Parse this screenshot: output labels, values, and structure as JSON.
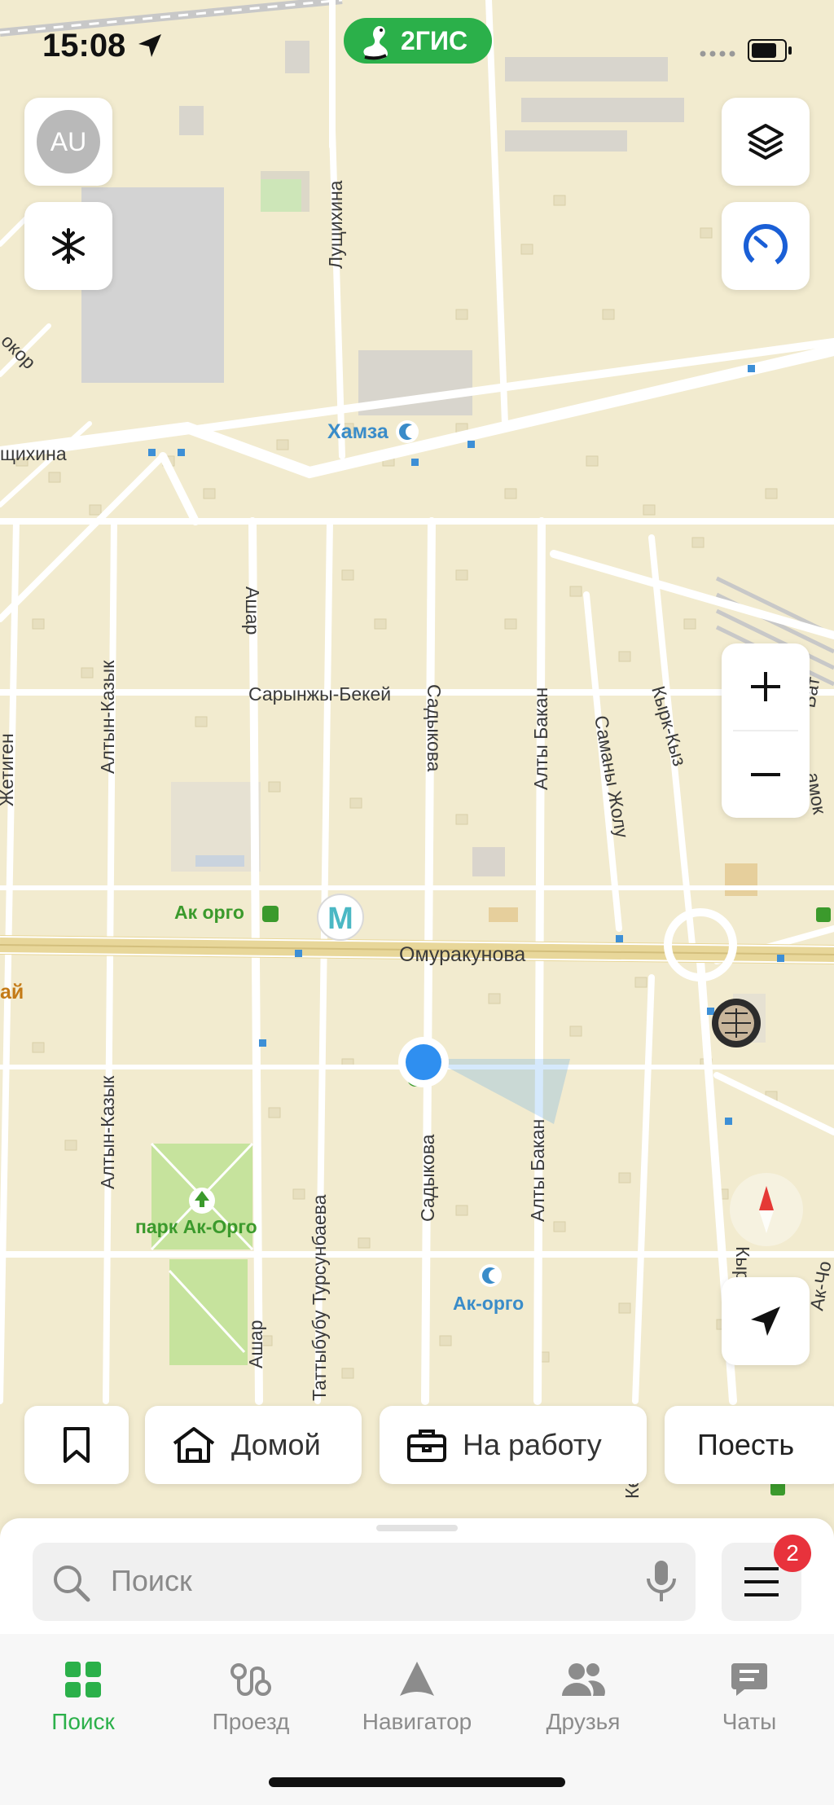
{
  "status": {
    "time": "15:08",
    "app_logo": "2ГИС"
  },
  "profile": {
    "initials": "AU"
  },
  "map": {
    "streets": [
      {
        "text": "Лущихина"
      },
      {
        "text": "щихина"
      },
      {
        "text": "окор"
      },
      {
        "text": "Ашар"
      },
      {
        "text": "Сарынжы-Бекей"
      },
      {
        "text": "Садыкова"
      },
      {
        "text": "Алты Бакан"
      },
      {
        "text": "Саманы Жолу"
      },
      {
        "text": "Кырк-Кыз"
      },
      {
        "text": "Алтын-Казык"
      },
      {
        "text": "Жетиген"
      },
      {
        "text": "Омуракунова"
      },
      {
        "text": "Алтын-Казык"
      },
      {
        "text": "Таттыбубу Турсунбаева"
      },
      {
        "text": "Садыкова"
      },
      {
        "text": "Алты Бакан"
      },
      {
        "text": "Ашар"
      },
      {
        "text": "Кыр"
      },
      {
        "text": "Ак-Чо"
      },
      {
        "text": "Бат"
      },
      {
        "text": "амок"
      },
      {
        "text": "Кер"
      }
    ],
    "pois": {
      "hamza": "Хамза",
      "ak_orgo_metro": "Ак орго",
      "metro_letter": "М",
      "park": "парк Ак-Орго",
      "mosque": "Ак-орго",
      "edge_label": "ай"
    }
  },
  "controls": {
    "zoom_in": "+",
    "zoom_out": "−"
  },
  "quick_chips": [
    {
      "label": "Домой",
      "icon": "house-icon"
    },
    {
      "label": "На работу",
      "icon": "briefcase-icon"
    },
    {
      "label": "Поесть",
      "icon": ""
    }
  ],
  "search": {
    "placeholder": "Поиск"
  },
  "menu": {
    "badge_count": "2"
  },
  "tabs": [
    {
      "label": "Поиск",
      "icon": "grid-icon",
      "active": true
    },
    {
      "label": "Проезд",
      "icon": "route-icon",
      "active": false
    },
    {
      "label": "Навигатор",
      "icon": "navigator-icon",
      "active": false
    },
    {
      "label": "Друзья",
      "icon": "friends-icon",
      "active": false
    },
    {
      "label": "Чаты",
      "icon": "chat-icon",
      "active": false
    }
  ],
  "colors": {
    "accent": "#2bb04a",
    "badge": "#e8323c",
    "map_bg": "#f2ebcf",
    "road": "#ffffff",
    "location": "#2f8ff0"
  }
}
